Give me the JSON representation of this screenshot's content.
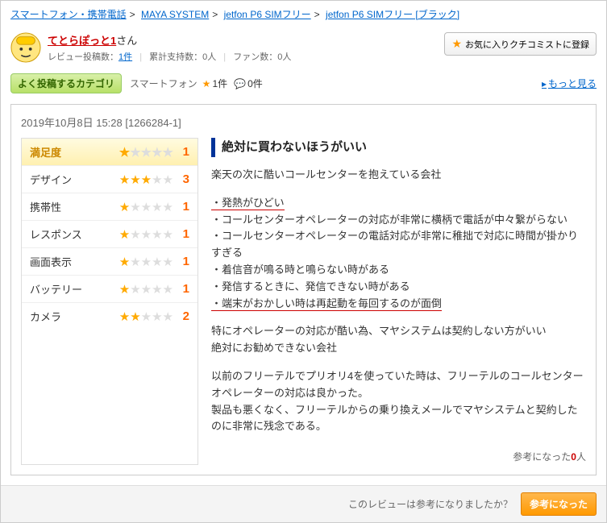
{
  "breadcrumb": [
    {
      "label": "スマートフォン・携帯電話"
    },
    {
      "label": "MAYA SYSTEM"
    },
    {
      "label": "jetfon P6 SIMフリー"
    },
    {
      "label": "jetfon P6 SIMフリー [ブラック]"
    }
  ],
  "user": {
    "name": "てとらぽっと1",
    "suffix": "さん",
    "review_count_label": "レビュー投稿数：",
    "review_count": "1件",
    "support_label": "累計支持数：",
    "support_count": "0人",
    "fan_label": "ファン数：",
    "fan_count": "0人"
  },
  "fav_button": "お気に入りクチコミストに登録",
  "category": {
    "label": "よく投稿するカテゴリ",
    "item": "スマートフォン",
    "stars": "1件",
    "comments": "0件"
  },
  "more": "もっと見る",
  "review": {
    "date": "2019年10月8日 15:28 [1266284-1]",
    "title": "絶対に買わないほうがいい",
    "ratings": {
      "header": "満足度",
      "items": [
        {
          "label": "満足度",
          "stars": 1,
          "score": "1"
        },
        {
          "label": "デザイン",
          "stars": 3,
          "score": "3"
        },
        {
          "label": "携帯性",
          "stars": 1,
          "score": "1"
        },
        {
          "label": "レスポンス",
          "stars": 1,
          "score": "1"
        },
        {
          "label": "画面表示",
          "stars": 1,
          "score": "1"
        },
        {
          "label": "バッテリー",
          "stars": 1,
          "score": "1"
        },
        {
          "label": "カメラ",
          "stars": 2,
          "score": "2"
        }
      ]
    },
    "body": {
      "p1": "楽天の次に酷いコールセンターを抱えている会社",
      "l1": "・発熱がひどい",
      "l2": "・コールセンターオペレーターの対応が非常に横柄で電話が中々繋がらない",
      "l3": "・コールセンターオペレーターの電話対応が非常に稚拙で対応に時間が掛かりすぎる",
      "l4": "・着信音が鳴る時と鳴らない時がある",
      "l5": "・発信するときに、発信できない時がある",
      "l6": "・端末がおかしい時は再起動を毎回するのが面倒",
      "p2a": "特にオペレーターの対応が酷い為、マヤシステムは契約しない方がいい",
      "p2b": "絶対にお勧めできない会社",
      "p3a": "以前のフリーテルでプリオリ4を使っていた時は、フリーテルのコールセンターオペレーターの対応は良かった。",
      "p3b": "製品も悪くなく、フリーテルからの乗り換えメールでマヤシステムと契約したのに非常に残念である。"
    },
    "helpful_label": "参考になった",
    "helpful_count": "0",
    "helpful_unit": "人"
  },
  "footer": {
    "question": "このレビューは参考になりましたか？",
    "button": "参考になった"
  }
}
